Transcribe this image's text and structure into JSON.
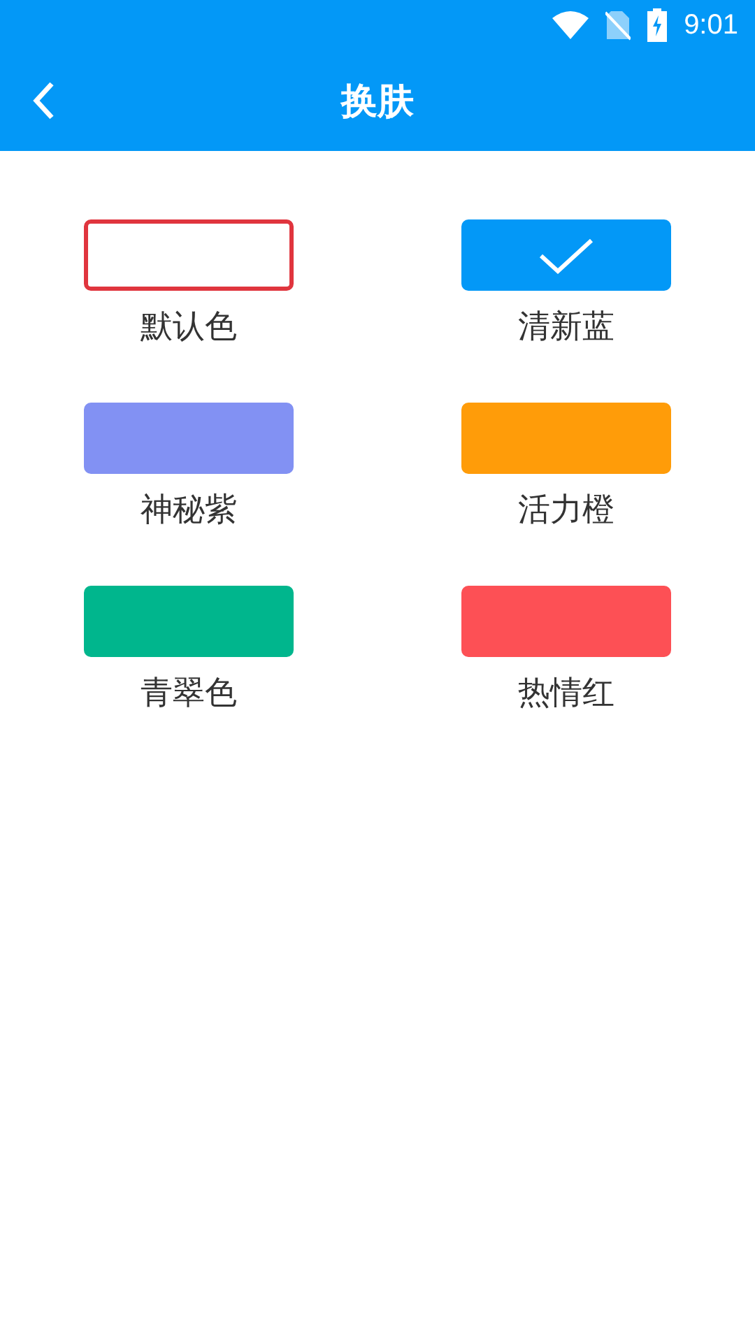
{
  "status_bar": {
    "time": "9:01"
  },
  "header": {
    "title": "换肤"
  },
  "skins": [
    {
      "label": "默认色",
      "kind": "outline",
      "color": "#e0353e",
      "selected": false
    },
    {
      "label": "清新蓝",
      "kind": "fill",
      "color": "#0398f7",
      "selected": true
    },
    {
      "label": "神秘紫",
      "kind": "fill",
      "color": "#8291f3",
      "selected": false
    },
    {
      "label": "活力橙",
      "kind": "fill",
      "color": "#ff9c09",
      "selected": false
    },
    {
      "label": "青翠色",
      "kind": "fill",
      "color": "#00b68d",
      "selected": false
    },
    {
      "label": "热情红",
      "kind": "fill",
      "color": "#fd5055",
      "selected": false
    }
  ]
}
